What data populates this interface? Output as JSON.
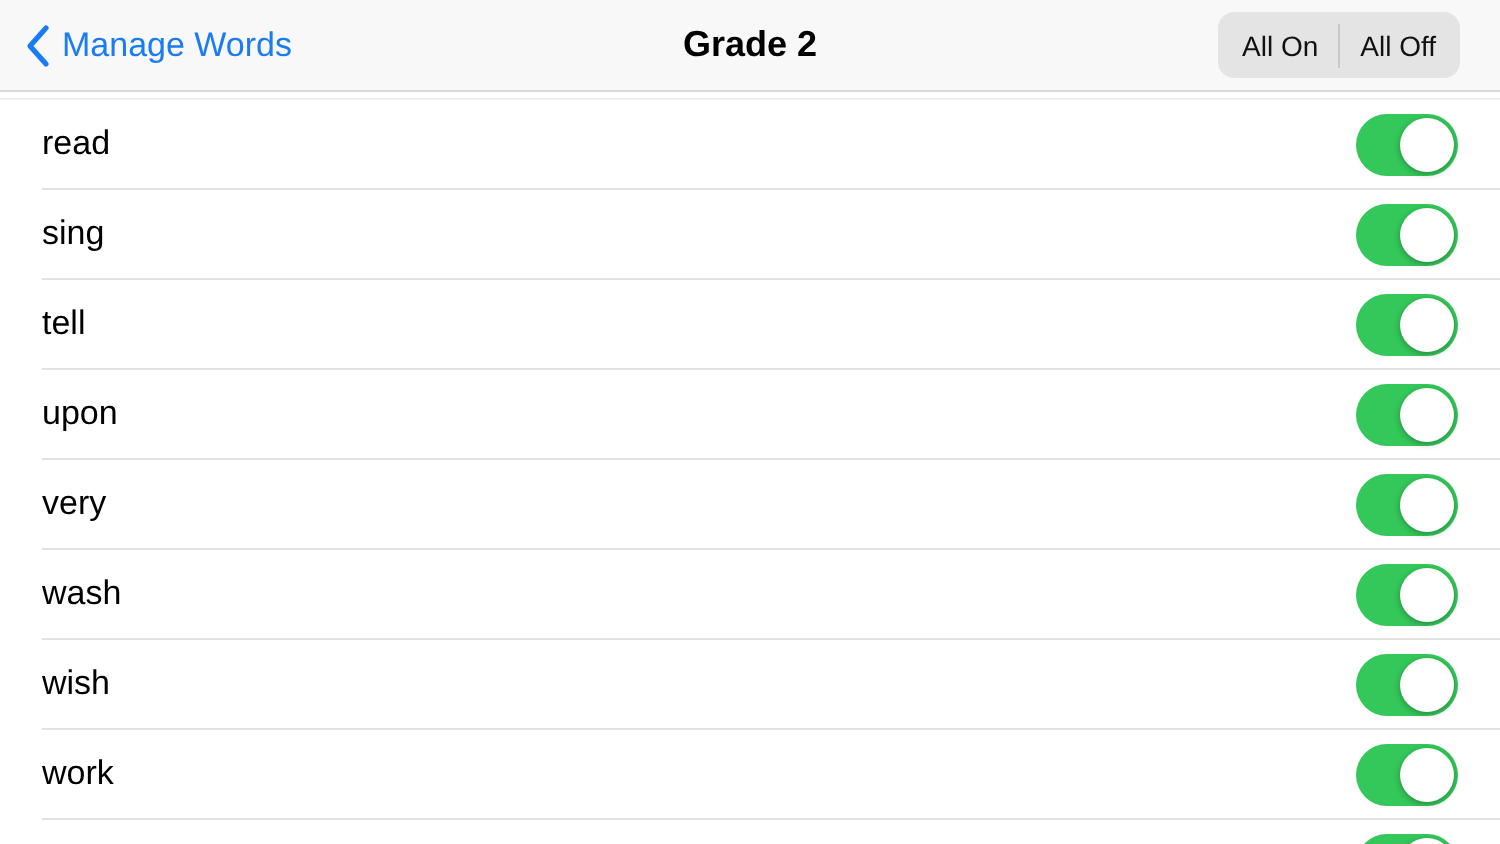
{
  "nav": {
    "back": "Manage Words",
    "title": "Grade 2",
    "segments": [
      {
        "label": "All On",
        "selected": false
      },
      {
        "label": "All Off",
        "selected": false
      }
    ]
  },
  "words": [
    {
      "word": "read",
      "on": true
    },
    {
      "word": "sing",
      "on": true
    },
    {
      "word": "tell",
      "on": true
    },
    {
      "word": "upon",
      "on": true
    },
    {
      "word": "very",
      "on": true
    },
    {
      "word": "wash",
      "on": true
    },
    {
      "word": "wish",
      "on": true
    },
    {
      "word": "work",
      "on": true
    },
    {
      "on": true
    }
  ]
}
